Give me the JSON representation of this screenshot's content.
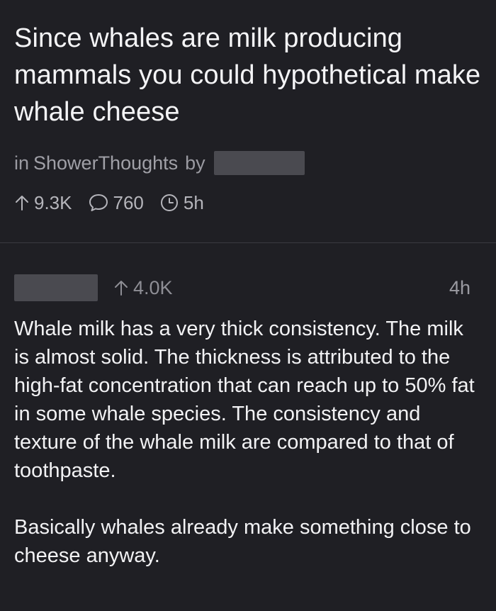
{
  "post": {
    "title": "Since whales are milk producing mammals you could hypothetical make whale cheese",
    "in_label": "in",
    "community": "ShowerThoughts",
    "by_label": "by",
    "upvotes": "9.3K",
    "comments": "760",
    "age": "5h"
  },
  "comment": {
    "upvotes": "4.0K",
    "age": "4h",
    "paragraphs": [
      "Whale milk has a very thick consistency. The milk is almost solid. The thickness is attributed to the high-fat concentration that can reach up to 50% fat in some whale species. The consistency and texture of the whale milk are compared to that of toothpaste.",
      "Basically whales already make something close to cheese anyway."
    ]
  },
  "colors": {
    "background": "#1f1f24",
    "text": "#f2f2f4",
    "muted": "#9a9aa1",
    "redaction": "#4a4a50"
  }
}
